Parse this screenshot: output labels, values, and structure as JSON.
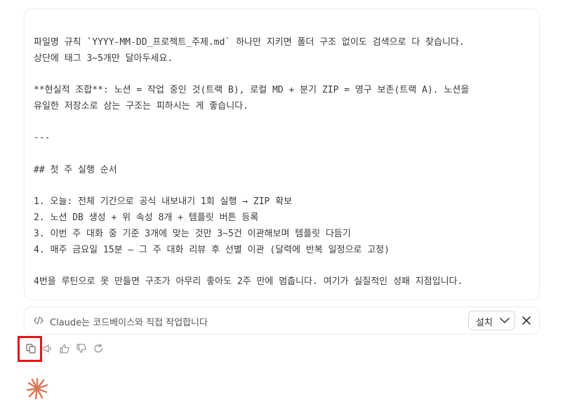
{
  "message": {
    "lines": [
      "파일명 규칙 `YYYY-MM-DD_프로젝트_주제.md` 하나만 지키면 폴더 구조 없이도 검색으로 다 찾습니다.",
      "상단에 태그 3~5개만 달아두세요.",
      "**현실적 조합**: 노션 = 작업 중인 것(트랙 B), 로컬 MD + 분기 ZIP = 영구 보존(트랙 A). 노션을",
      "유일한 저장소로 삼는 구조는 피하시는 게 좋습니다.",
      "---",
      "## 첫 주 실행 순서",
      "1. 오늘: 전체 기간으로 공식 내보내기 1회 실행 → ZIP 확보",
      "2. 노션 DB 생성 + 위 속성 8개 + 템플릿 버튼 등록",
      "3. 이번 주 대화 중 기준 3개에 맞는 것만 3~5건 이관해보며 템플릿 다듬기",
      "4. 매주 금요일 15분 — 그 주 대화 리뷰 후 선별 이관 (달력에 반복 일정으로 고정)",
      "4번을 루틴으로 못 만들면 구조가 아무리 좋아도 2주 만에 멈춥니다. 여기가 실질적인 성패 지점입니다."
    ]
  },
  "banner": {
    "icon": "code-icon",
    "text": "Claude는 코드베이스와 직접 작업합니다",
    "install_label": "설치",
    "install_icon": "chevron-down-icon",
    "close_icon": "close-icon"
  },
  "actions": {
    "items": [
      "copy-icon",
      "speaker-icon",
      "thumbs-up-icon",
      "thumbs-down-icon",
      "retry-icon"
    ],
    "highlighted": "copy-icon",
    "highlight_color": "#e0141e"
  },
  "assistant": {
    "logo": "claude-spark-icon",
    "logo_color": "#d97757"
  }
}
